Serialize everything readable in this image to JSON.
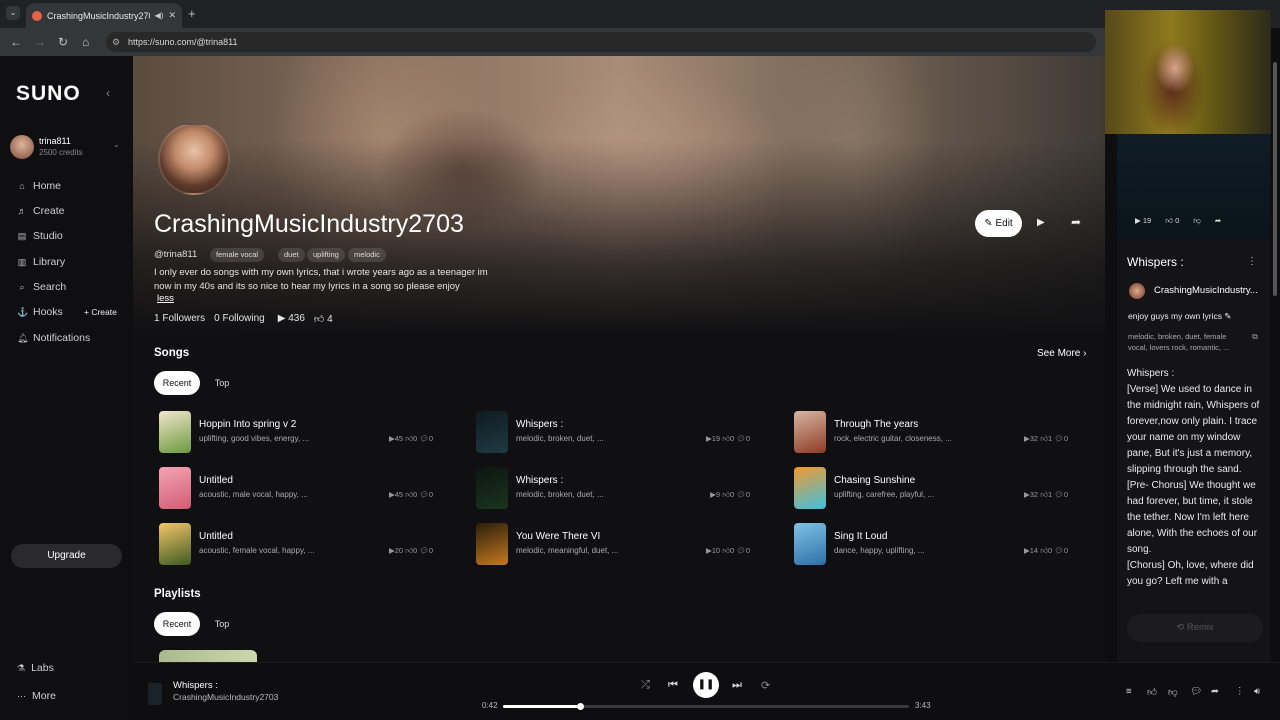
{
  "browser": {
    "tab_title": "CrashingMusicIndustry2703",
    "url": "https://suno.com/@trina811"
  },
  "sidebar": {
    "logo": "SUNO",
    "user": {
      "name": "trina811",
      "credits": "2500 credits"
    },
    "items": [
      {
        "icon": "home-icon",
        "label": "Home"
      },
      {
        "icon": "create-icon",
        "label": "Create"
      },
      {
        "icon": "studio-icon",
        "label": "Studio"
      },
      {
        "icon": "library-icon",
        "label": "Library"
      },
      {
        "icon": "search-icon",
        "label": "Search"
      },
      {
        "icon": "hooks-icon",
        "label": "Hooks"
      },
      {
        "icon": "bell-icon",
        "label": "Notifications"
      }
    ],
    "hooks_create": "+ Create",
    "upgrade": "Upgrade",
    "labs": "Labs",
    "more": "More"
  },
  "profile": {
    "name": "CrashingMusicIndustry2703",
    "handle": "@trina811",
    "tags": [
      "female vocal",
      "duet",
      "uplifting",
      "melodic"
    ],
    "bio": "I only ever do songs with my own lyrics, that i wrote years ago as a teenager im now in my 40s and its so nice to hear my lyrics in a song so please enjoy",
    "less": "less",
    "followers": "1 Followers",
    "following": "0 Following",
    "plays": "436",
    "likes": "4",
    "edit": "Edit"
  },
  "songs": {
    "title": "Songs",
    "see_more": "See More",
    "tabs": [
      "Recent",
      "Top"
    ],
    "list": [
      {
        "title": "Hoppin Into spring v 2",
        "tags": "uplifting, good vibes, energy, ...",
        "plays": "45",
        "likes": "0",
        "comments": "0",
        "colors": [
          "#f3e6cf",
          "#6c9a3d"
        ]
      },
      {
        "title": "Whispers :",
        "tags": "melodic, broken, duet, ...",
        "plays": "19",
        "likes": "0",
        "comments": "0",
        "colors": [
          "#0f1a20",
          "#1f3a42"
        ]
      },
      {
        "title": "Through The years",
        "tags": "rock, electric guitar, closeness, ...",
        "plays": "32",
        "likes": "1",
        "comments": "0",
        "colors": [
          "#d8b7a2",
          "#8d3a25"
        ]
      },
      {
        "title": "Untitled",
        "tags": "acoustic, male vocal, happy, ...",
        "plays": "45",
        "likes": "0",
        "comments": "0",
        "colors": [
          "#f2a5b2",
          "#d45b74"
        ]
      },
      {
        "title": "Whispers :",
        "tags": "melodic, broken, duet, ...",
        "plays": "9",
        "likes": "0",
        "comments": "0",
        "colors": [
          "#0b1510",
          "#1c3420"
        ]
      },
      {
        "title": "Chasing Sunshine",
        "tags": "uplifting, carefree, playful, ...",
        "plays": "32",
        "likes": "1",
        "comments": "0",
        "colors": [
          "#f29a2e",
          "#3fbfe0"
        ]
      },
      {
        "title": "Untitled",
        "tags": "acoustic, female vocal, happy, ...",
        "plays": "20",
        "likes": "0",
        "comments": "0",
        "colors": [
          "#f4c66b",
          "#3d5a20"
        ]
      },
      {
        "title": "You Were There VI",
        "tags": "melodic, meaningful, duet, ...",
        "plays": "10",
        "likes": "0",
        "comments": "0",
        "colors": [
          "#2a1e0a",
          "#c57a20"
        ]
      },
      {
        "title": "Sing It Loud",
        "tags": "dance, happy, uplifting, ...",
        "plays": "14",
        "likes": "0",
        "comments": "0",
        "colors": [
          "#7fc3e6",
          "#2f6fa8"
        ]
      }
    ]
  },
  "playlists": {
    "title": "Playlists",
    "tabs": [
      "Recent",
      "Top"
    ]
  },
  "now_playing_panel": {
    "plays": "19",
    "likes": "0",
    "title": "Whispers :",
    "artist": "CrashingMusicIndustry...",
    "caption": "enjoy guys my own lyrics",
    "tags": "melodic, broken, duet, female vocal, lovers rock, romantic, ...",
    "lyrics": [
      "Whispers :",
      "[Verse] We used to dance in the midnight rain, Whispers of forever,now only plain. I trace your name on my window pane, But it's just a memory, slipping through the sand.",
      "[Pre- Chorus] We thought we had forever, but time, it stole the tether. Now I'm left here alone, With the echoes of our song.",
      "[Chorus] Oh, love, where did you go? Left me with a"
    ],
    "remix": "Remix"
  },
  "player": {
    "title": "Whispers :",
    "artist": "CrashingMusicIndustry2703",
    "current": "0:42",
    "duration": "3:43",
    "progress": 0.19
  }
}
